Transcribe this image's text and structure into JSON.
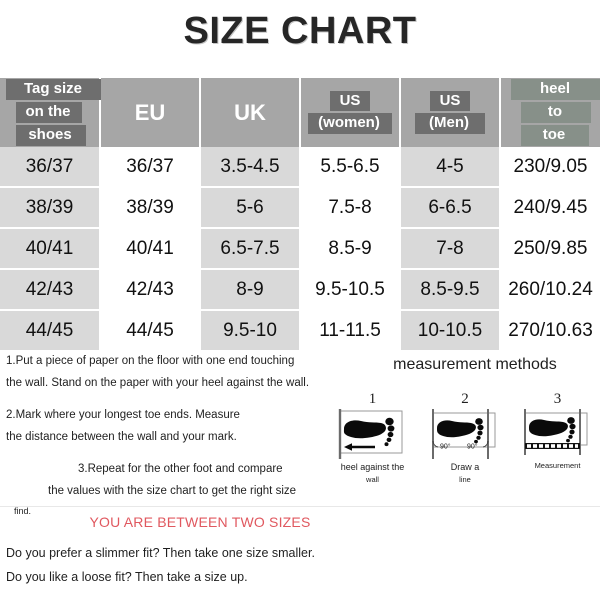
{
  "page": {
    "title": "SIZE CHART"
  },
  "table": {
    "headers": [
      {
        "id": "tag-size",
        "type": "stacked",
        "lines": [
          "Tag size",
          "on the",
          "shoes"
        ]
      },
      {
        "id": "eu",
        "type": "simple",
        "label": "EU"
      },
      {
        "id": "uk",
        "type": "simple",
        "label": "UK"
      },
      {
        "id": "us-women",
        "type": "stacked",
        "lines": [
          "US",
          "(women)"
        ]
      },
      {
        "id": "us-men",
        "type": "stacked",
        "lines": [
          "US",
          "(Men)"
        ]
      },
      {
        "id": "heel-to-toe",
        "type": "stacked",
        "lines": [
          "heel",
          "to",
          "toe"
        ]
      }
    ],
    "rows": [
      [
        "36/37",
        "36/37",
        "3.5-4.5",
        "5.5-6.5",
        "4-5",
        "230/9.05"
      ],
      [
        "38/39",
        "38/39",
        "5-6",
        "7.5-8",
        "6-6.5",
        "240/9.45"
      ],
      [
        "40/41",
        "40/41",
        "6.5-7.5",
        "8.5-9",
        "7-8",
        "250/9.85"
      ],
      [
        "42/43",
        "42/43",
        "8-9",
        "9.5-10.5",
        "8.5-9.5",
        "260/10.24"
      ],
      [
        "44/45",
        "44/45",
        "9.5-10",
        "11-11.5",
        "10-10.5",
        "270/10.63"
      ]
    ]
  },
  "instructions": {
    "step1_line1": "1.Put a piece of paper on the floor with one end touching",
    "step1_line2": "the wall. Stand on the paper with your heel against the wall.",
    "step2_line1": "2.Mark where your longest toe ends. Measure",
    "step2_line2": "the distance between the wall and your mark.",
    "step3_line1": "3.Repeat for the other foot and compare",
    "step3_line2": "the values with the size chart to get the right size",
    "step3_line3": "find."
  },
  "measurement": {
    "title": "measurement methods",
    "diagrams": [
      {
        "number": "1",
        "caption_line1": "heel against the",
        "caption_line2": "wall",
        "icon": "foot-against-wall-icon"
      },
      {
        "number": "2",
        "caption_line1": "Draw a",
        "caption_line2": "line",
        "angle_left": "90°",
        "angle_right": "90°",
        "icon": "foot-draw-line-icon"
      },
      {
        "number": "3",
        "caption_line1": "Measurement",
        "caption_line2": "",
        "icon": "foot-measure-ruler-icon"
      }
    ]
  },
  "notes": {
    "between_sizes": "YOU ARE BETWEEN TWO SIZES",
    "fit_slimmer": "Do you prefer a slimmer fit? Then take one size smaller.",
    "fit_loose": "Do you like a loose fit? Then take a size up."
  },
  "colors": {
    "header_bg": "#a6a6a6",
    "chip_gray": "#6e6e6e",
    "chip_green": "#879089",
    "row_shade": "#d9d9d9",
    "row_white": "#ffffff",
    "accent_red": "#e0585f",
    "text_dark": "#1f1f1f"
  }
}
